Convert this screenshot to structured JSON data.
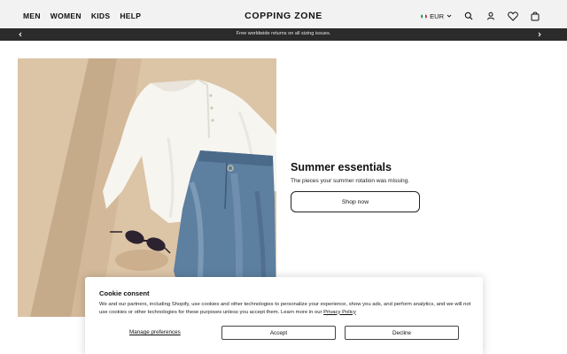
{
  "header": {
    "nav": [
      "MEN",
      "WOMEN",
      "KIDS",
      "HELP"
    ],
    "logo": "COPPING ZONE",
    "currency": "EUR",
    "icons": [
      "search-icon",
      "account-icon",
      "wishlist-heart-icon",
      "cart-bag-icon"
    ]
  },
  "announcement": {
    "text": "Free worldwide returns on all sizing issues."
  },
  "hero": {
    "title": "Summer essentials",
    "subtitle": "The pieces your summer rotation was missing.",
    "button": "Shop now"
  },
  "cookie": {
    "title": "Cookie consent",
    "body": "We and our partners, including Shopify, use cookies and other technologies to personalize your experience, show you ads, and perform analytics, and we will not use cookies or other technologies for these purposes unless you accept them. Learn more in our",
    "link": "Privacy Policy",
    "manage": "Manage preferences",
    "accept": "Accept",
    "decline": "Decline"
  },
  "colors": {
    "header_bg": "#f2f2f2",
    "announce_bg": "#2b2b2b",
    "flag": [
      "#009246",
      "#ffffff",
      "#ce2b37"
    ]
  }
}
